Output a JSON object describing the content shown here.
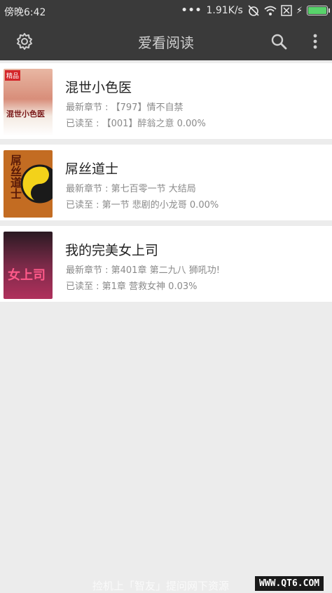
{
  "status_bar": {
    "time": "傍晚6:42",
    "speed": "1.91K/s"
  },
  "app_bar": {
    "title": "爱看阅读",
    "icons": [
      "gear-icon",
      "search-icon",
      "more-vertical-icon"
    ]
  },
  "books": [
    {
      "name": "混世小色医",
      "latest": "最新章节 : 【797】情不自禁",
      "progress": "已读至 : 【001】醉翁之意 0.00%",
      "progress_value": 0.0,
      "cover_text": "混世小色医",
      "cover_badge": "精品"
    },
    {
      "name": "屌丝道士",
      "latest": "最新章节 : 第七百零一节 大结局",
      "progress": "已读至 : 第一节 悲剧的小龙哥 0.00%",
      "progress_value": 0.0,
      "cover_text": "屌丝道士"
    },
    {
      "name": "我的完美女上司",
      "latest": "最新章节 : 第401章 第二九八 狮吼功!",
      "progress": "已读至 : 第1章 营救女神 0.03%",
      "progress_value": 0.03,
      "cover_text": "女上司"
    }
  ],
  "watermark": {
    "text": "捡机上「智友」提问网下资源",
    "site": "WWW.QT6.COM"
  },
  "colors": {
    "bar": "#3a3a3a",
    "background": "#ececec",
    "battery": "#58d36b"
  }
}
